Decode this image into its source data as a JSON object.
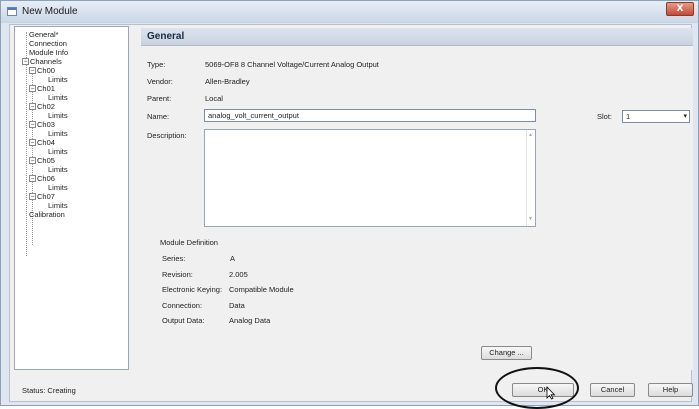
{
  "window": {
    "title": "New Module",
    "close_glyph": "X"
  },
  "tree": {
    "items": [
      {
        "label": "General*",
        "level": 1
      },
      {
        "label": "Connection",
        "level": 1
      },
      {
        "label": "Module Info",
        "level": 1
      },
      {
        "label": "Channels",
        "level": 1
      },
      {
        "label": "Ch00",
        "level": 2
      },
      {
        "label": "Limits",
        "level": 3
      },
      {
        "label": "Ch01",
        "level": 2
      },
      {
        "label": "Limits",
        "level": 3
      },
      {
        "label": "Ch02",
        "level": 2
      },
      {
        "label": "Limits",
        "level": 3
      },
      {
        "label": "Ch03",
        "level": 2
      },
      {
        "label": "Limits",
        "level": 3
      },
      {
        "label": "Ch04",
        "level": 2
      },
      {
        "label": "Limits",
        "level": 3
      },
      {
        "label": "Ch05",
        "level": 2
      },
      {
        "label": "Limits",
        "level": 3
      },
      {
        "label": "Ch06",
        "level": 2
      },
      {
        "label": "Limits",
        "level": 3
      },
      {
        "label": "Ch07",
        "level": 2
      },
      {
        "label": "Limits",
        "level": 3
      },
      {
        "label": "Calibration",
        "level": 1
      }
    ]
  },
  "general": {
    "header": "General",
    "type_label": "Type:",
    "type_value": "5069-OF8 8 Channel Voltage/Current Analog Output",
    "vendor_label": "Vendor:",
    "vendor_value": "Allen-Bradley",
    "parent_label": "Parent:",
    "parent_value": "Local",
    "name_label": "Name:",
    "name_value": "analog_volt_current_output",
    "slot_label": "Slot:",
    "slot_value": "1",
    "description_label": "Description:",
    "description_value": ""
  },
  "module_definition": {
    "heading": "Module Definition",
    "series_label": "Series:",
    "series_value": "A",
    "revision_label": "Revision:",
    "revision_value": "2.005",
    "keying_label": "Electronic Keying:",
    "keying_value": "Compatible Module",
    "connection_label": "Connection:",
    "connection_value": "Data",
    "output_label": "Output Data:",
    "output_value": "Analog Data"
  },
  "buttons": {
    "change": "Change ...",
    "ok": "OK",
    "cancel": "Cancel",
    "help": "Help"
  },
  "status": {
    "text": "Status: Creating"
  }
}
